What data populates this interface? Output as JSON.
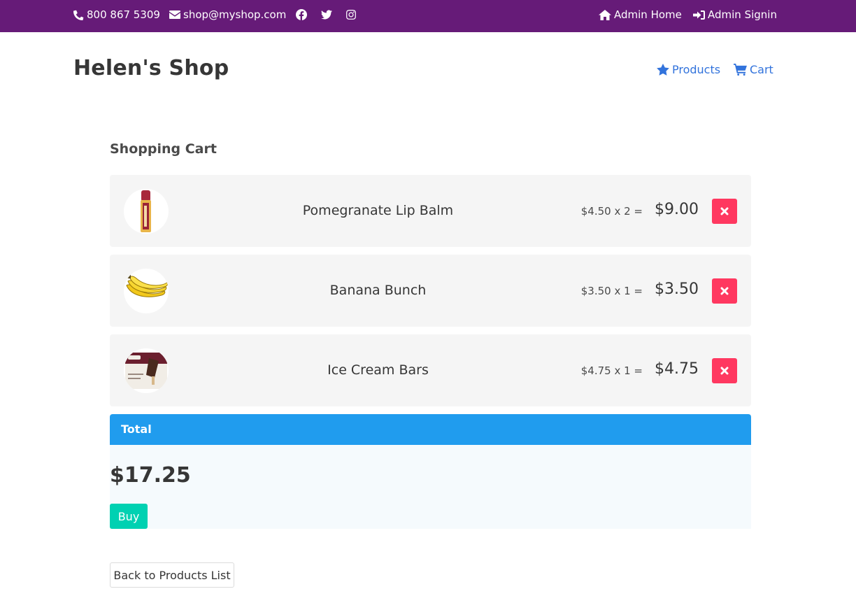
{
  "topbar": {
    "phone": "800 867 5309",
    "email": "shop@myshop.com",
    "social": [
      "facebook-icon",
      "twitter-icon",
      "instagram-icon"
    ],
    "admin_home": "Admin Home",
    "admin_signin": "Admin Signin",
    "bg_color": "#661b78"
  },
  "header": {
    "brand": "Helen's Shop",
    "nav": {
      "products": "Products",
      "cart": "Cart"
    },
    "link_color": "#3273dc"
  },
  "cart": {
    "title": "Shopping Cart",
    "items": [
      {
        "name": "Pomegranate Lip Balm",
        "calc": "$4.50 x 2 =",
        "total": "$9.00"
      },
      {
        "name": "Banana Bunch",
        "calc": "$3.50 x 1 =",
        "total": "$3.50"
      },
      {
        "name": "Ice Cream Bars",
        "calc": "$4.75 x 1 =",
        "total": "$4.75"
      }
    ],
    "delete_color": "#ff3860"
  },
  "total": {
    "heading": "Total",
    "amount": "$17.25",
    "buy_label": "Buy",
    "heading_color": "#209cee",
    "buy_color": "#00d1b2"
  },
  "back_label": "Back to Products List"
}
